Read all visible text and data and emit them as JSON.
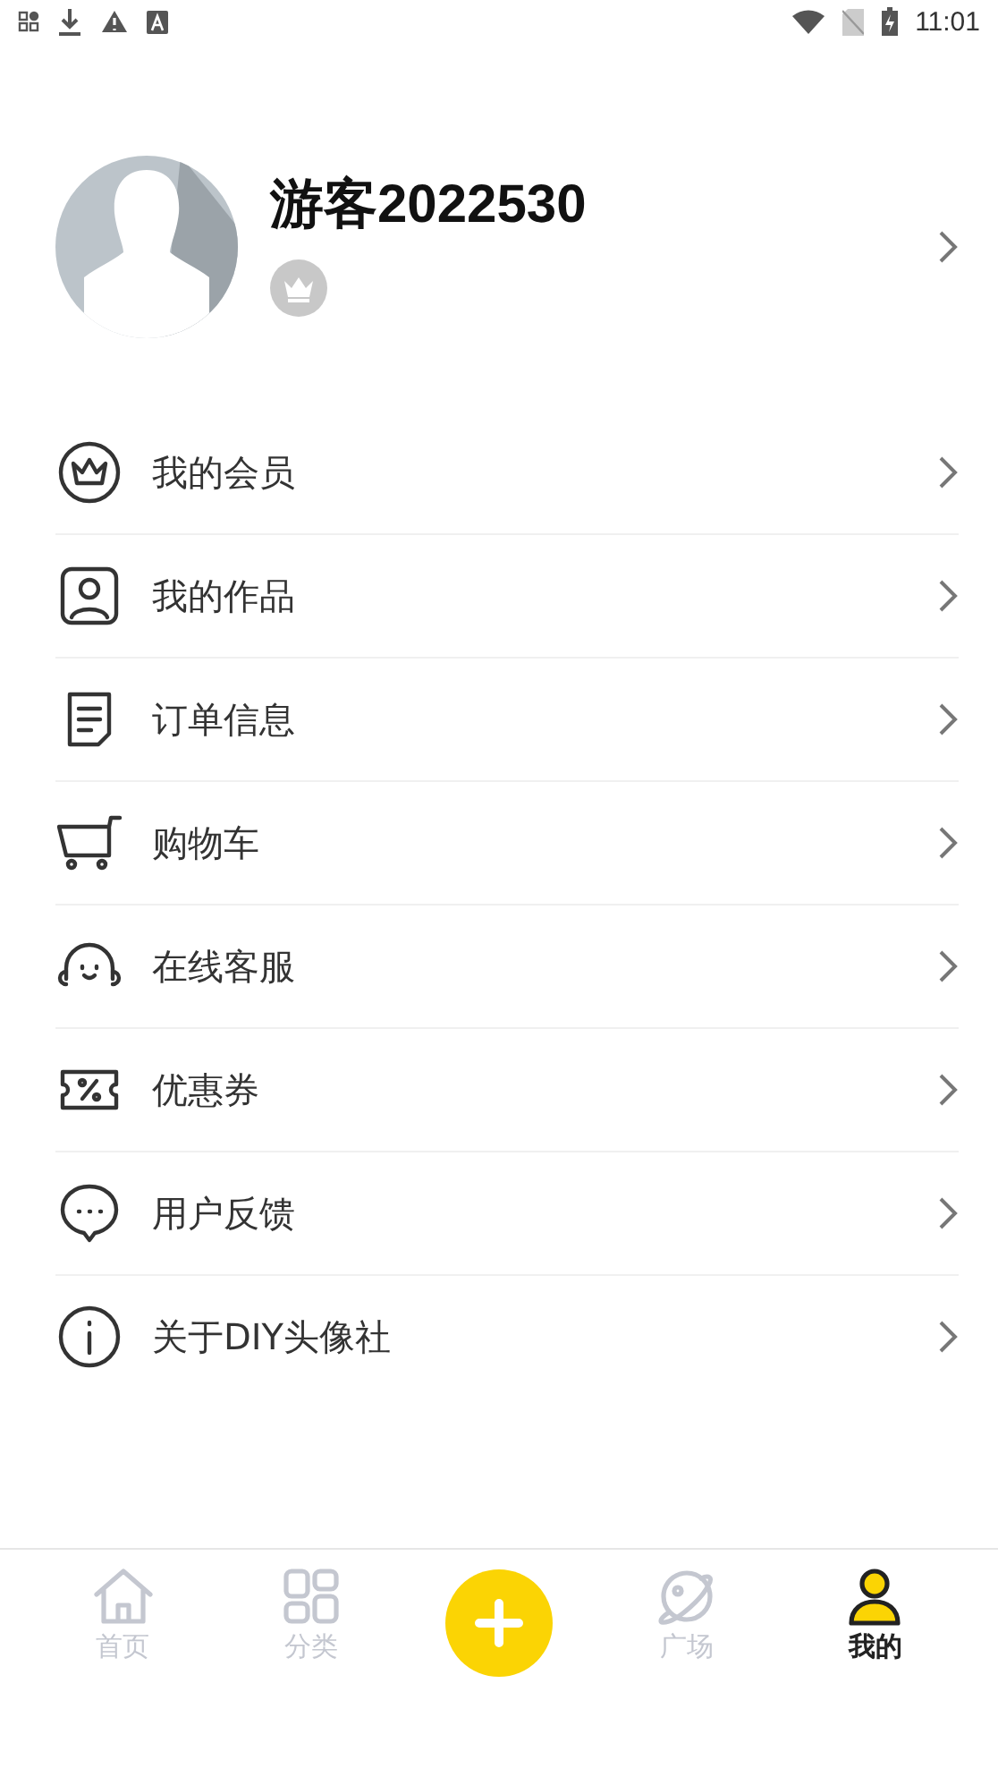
{
  "status_bar": {
    "time": "11:01"
  },
  "profile": {
    "name": "游客2022530",
    "vip": false
  },
  "menu": [
    {
      "label": "我的会员",
      "kind": "crown"
    },
    {
      "label": "我的作品",
      "kind": "portrait"
    },
    {
      "label": "订单信息",
      "kind": "document"
    },
    {
      "label": "购物车",
      "kind": "cart"
    },
    {
      "label": "在线客服",
      "kind": "headset"
    },
    {
      "label": "优惠券",
      "kind": "coupon"
    },
    {
      "label": "用户反馈",
      "kind": "chat"
    },
    {
      "label": "关于DIY头像社",
      "kind": "info"
    }
  ],
  "tab_bar": [
    {
      "label": "首页",
      "kind": "home",
      "selected": false
    },
    {
      "label": "分类",
      "kind": "grid",
      "selected": false
    },
    {
      "kind": "plus",
      "selected": false
    },
    {
      "label": "广场",
      "kind": "planet",
      "selected": false
    },
    {
      "label": "我的",
      "kind": "person",
      "selected": true
    }
  ]
}
